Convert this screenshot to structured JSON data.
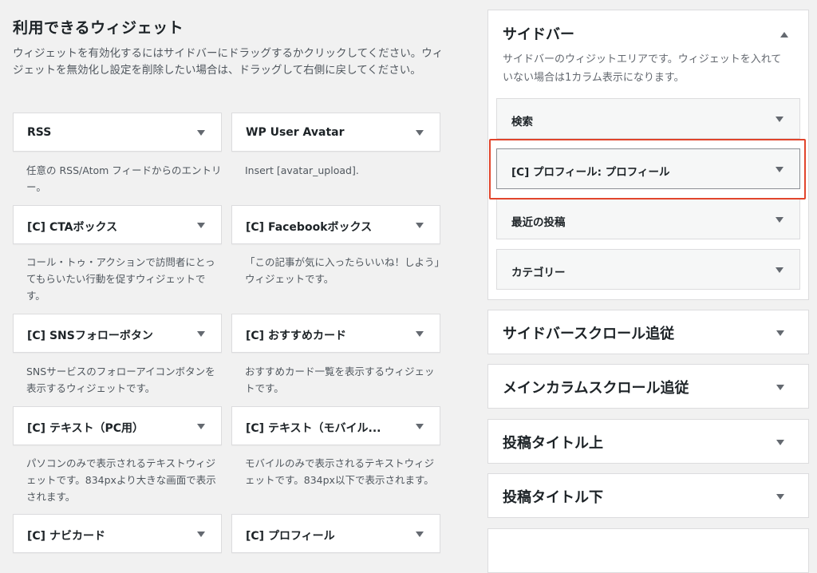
{
  "available": {
    "title": "利用できるウィジェット",
    "description": "ウィジェットを有効化するにはサイドバーにドラッグするかクリックしてください。ウィジェットを無効化し設定を削除したい場合は、ドラッグして右側に戻してください。",
    "widgets": [
      {
        "title": "RSS",
        "description": "任意の RSS/Atom フィードからのエントリー。"
      },
      {
        "title": "WP User Avatar",
        "description": "Insert [avatar_upload]."
      },
      {
        "title": "[C] CTAボックス",
        "description": "コール・トゥ・アクションで訪問者にとってもらいたい行動を促すウィジェットです。"
      },
      {
        "title": "[C] Facebookボックス",
        "description": "「この記事が気に入ったらいいね！しよう」ウィジェットです。"
      },
      {
        "title": "[C] SNSフォローボタン",
        "description": "SNSサービスのフォローアイコンボタンを表示するウィジェットです。"
      },
      {
        "title": "[C] おすすめカード",
        "description": "おすすめカード一覧を表示するウィジェットです。"
      },
      {
        "title": "[C] テキスト（PC用）",
        "description": "パソコンのみで表示されるテキストウィジェットです。834pxより大きな画面で表示されます。"
      },
      {
        "title": "[C] テキスト（モバイル...",
        "description": "モバイルのみで表示されるテキストウィジェットです。834px以下で表示されます。"
      },
      {
        "title": "[C] ナビカード",
        "description": ""
      },
      {
        "title": "[C] プロフィール",
        "description": ""
      }
    ]
  },
  "sidebar": {
    "title": "サイドバー",
    "description": "サイドバーのウィジットエリアです。ウィジェットを入れていない場合は1カラム表示になります。",
    "widgets": [
      {
        "title": "検索"
      },
      {
        "title": "[C] プロフィール: プロフィール"
      },
      {
        "title": "最近の投稿"
      },
      {
        "title": "カテゴリー"
      }
    ],
    "highlight_color": "#e1452c"
  },
  "areas": [
    {
      "title": "サイドバースクロール追従"
    },
    {
      "title": "メインカラムスクロール追従"
    },
    {
      "title": "投稿タイトル上"
    },
    {
      "title": "投稿タイトル下"
    }
  ]
}
